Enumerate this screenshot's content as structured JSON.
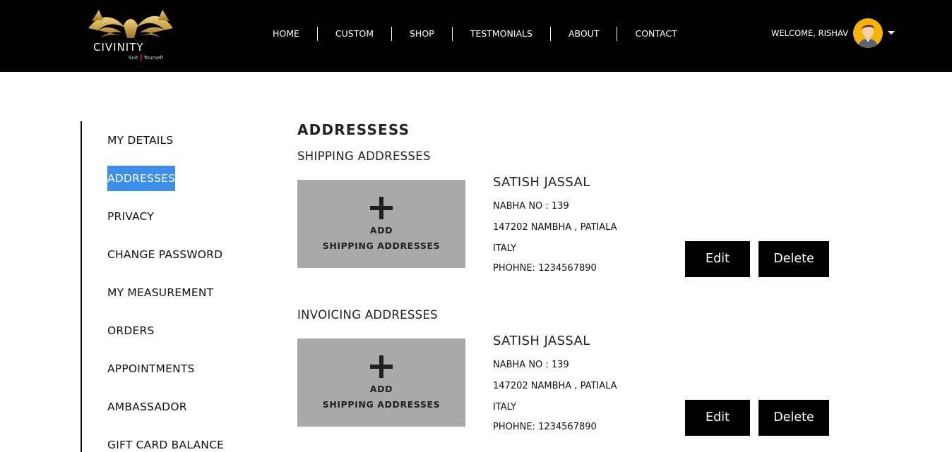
{
  "header": {
    "logo_text": "CIVINITY",
    "logo_tagline_left": "Suit",
    "logo_tagline_right": "Yourself",
    "nav": [
      "HOME",
      "CUSTOM",
      "SHOP",
      "TESTMONIALS",
      "ABOUT",
      "CONTACT"
    ],
    "welcome": "WELCOME, RISHAV",
    "colors": {
      "background": "#000000",
      "logo_gold": "#c9a23a"
    }
  },
  "sidebar": {
    "items": [
      {
        "label": "MY DETAILS"
      },
      {
        "label": "ADDRESSES",
        "active": true
      },
      {
        "label": "PRIVACY"
      },
      {
        "label": "CHANGE PASSWORD"
      },
      {
        "label": "MY MEASUREMENT"
      },
      {
        "label": "ORDERS"
      },
      {
        "label": "APPOINTMENTS"
      },
      {
        "label": "AMBASSADOR"
      },
      {
        "label": "GIFT CARD BALANCE"
      }
    ],
    "active_color": "#3b8eea"
  },
  "main": {
    "title": "ADDRESSESS",
    "sections": [
      {
        "heading": "SHIPPING ADDRESSES",
        "add_line1": "ADD",
        "add_line2": "SHIPPING ADDRESSES",
        "address": {
          "name": "SATISH JASSAL",
          "line1": "NABHA NO : 139",
          "line2": "147202 NAMBHA , PATIALA",
          "line3": "ITALY",
          "phone": "PHOHNE: 1234567890"
        },
        "edit_label": "Edit",
        "delete_label": "Delete"
      },
      {
        "heading": "INVOICING ADDRESSES",
        "add_line1": "ADD",
        "add_line2": "SHIPPING ADDRESSES",
        "address": {
          "name": "SATISH JASSAL",
          "line1": "NABHA NO : 139",
          "line2": "147202 NAMBHA , PATIALA",
          "line3": "ITALY",
          "phone": "PHOHNE: 1234567890"
        },
        "edit_label": "Edit",
        "delete_label": "Delete"
      }
    ]
  }
}
